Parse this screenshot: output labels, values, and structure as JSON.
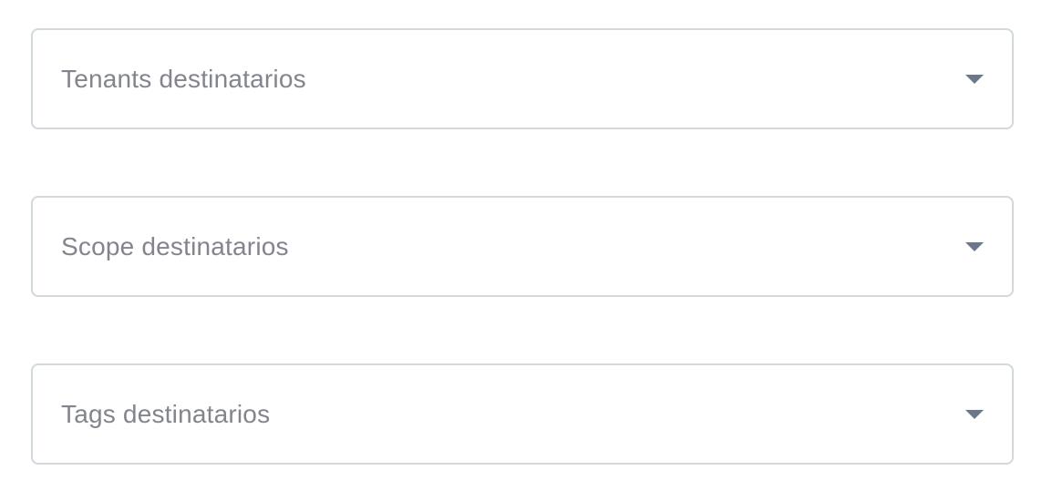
{
  "form": {
    "fields": [
      {
        "placeholder": "Tenants destinatarios",
        "icon": "chevron-down-icon"
      },
      {
        "placeholder": "Scope destinatarios",
        "icon": "chevron-down-icon"
      },
      {
        "placeholder": "Tags destinatarios",
        "icon": "chevron-down-icon"
      }
    ]
  },
  "colors": {
    "border": "#d3d7de",
    "placeholder_text": "#82858e",
    "caret": "#6c778b",
    "background": "#ffffff"
  }
}
